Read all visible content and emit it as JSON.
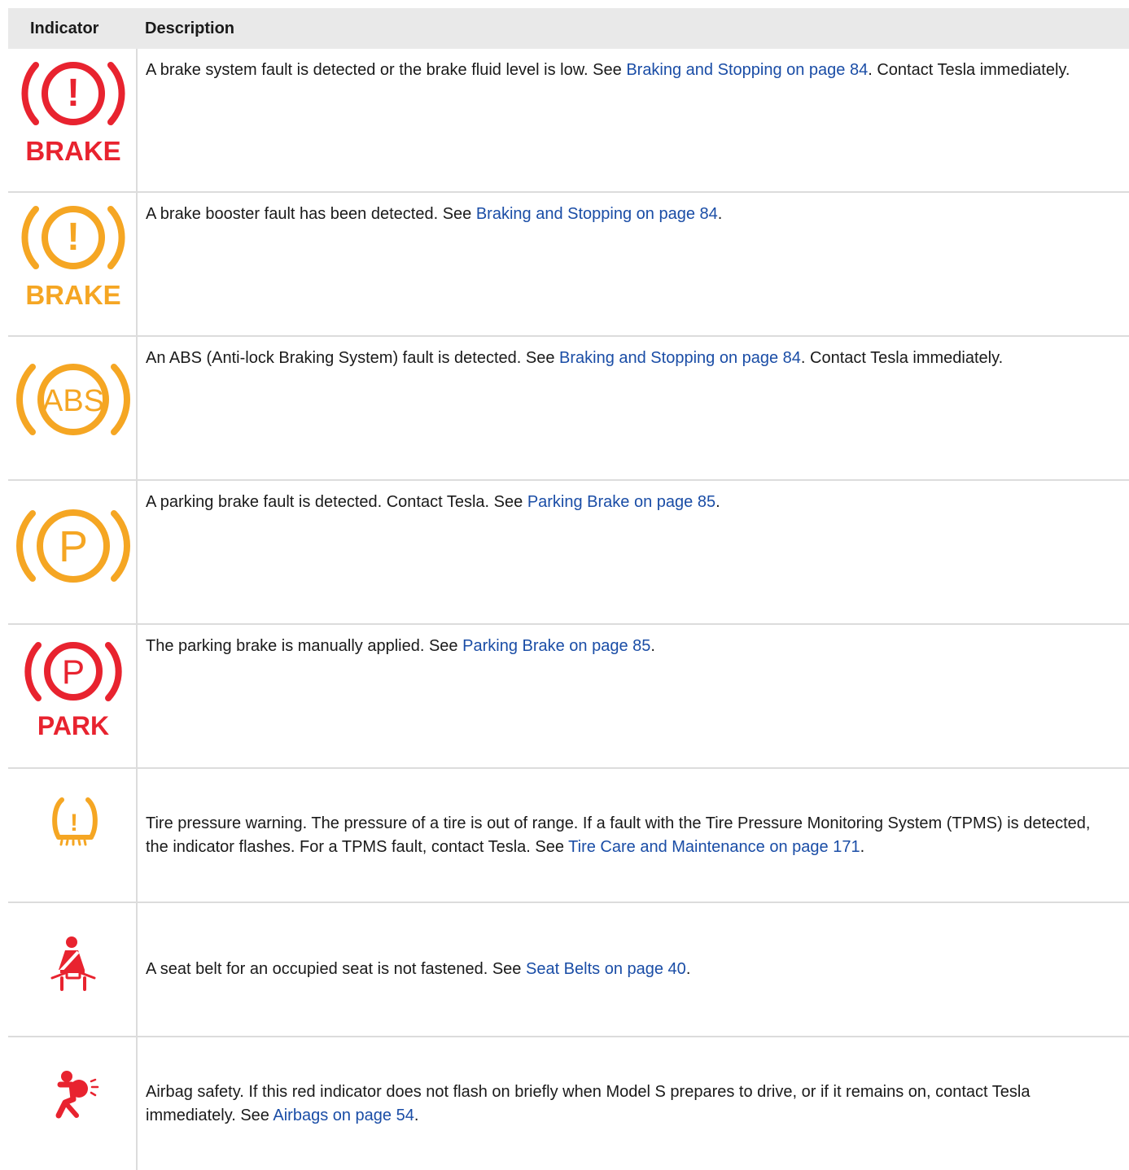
{
  "table": {
    "headers": {
      "indicator": "Indicator",
      "description": "Description"
    },
    "rows": [
      {
        "icon": "brake-red-icon",
        "icon_text": "BRAKE",
        "color": "#e8232f",
        "text_before": "A brake system fault is detected or the brake fluid level is low. See ",
        "link": "Braking and Stopping on page 84",
        "text_after": ". Contact Tesla immediately."
      },
      {
        "icon": "brake-amber-icon",
        "icon_text": "BRAKE",
        "color": "#f5a623",
        "text_before": "A brake booster fault has been detected. See ",
        "link": "Braking and Stopping on page 84",
        "text_after": "."
      },
      {
        "icon": "abs-icon",
        "icon_text": "ABS",
        "color": "#f5a623",
        "text_before": "An ABS (Anti-lock Braking System) fault is detected. See ",
        "link": "Braking and Stopping on page 84",
        "text_after": ". Contact Tesla immediately."
      },
      {
        "icon": "parking-brake-fault-icon",
        "icon_text": "P",
        "color": "#f5a623",
        "text_before": "A parking brake fault is detected. Contact Tesla. See ",
        "link": "Parking Brake on page 85",
        "text_after": "."
      },
      {
        "icon": "parking-brake-applied-icon",
        "icon_text": "P",
        "icon_subtext": "PARK",
        "color": "#e8232f",
        "text_before": "The parking brake is manually applied. See ",
        "link": "Parking Brake on page 85",
        "text_after": "."
      },
      {
        "icon": "tire-pressure-icon",
        "icon_text": "!",
        "color": "#f5a623",
        "text_before": "Tire pressure warning. The pressure of a tire is out of range. If a fault with the Tire Pressure Monitoring System (TPMS) is detected, the indicator flashes. For a TPMS fault, contact Tesla. See ",
        "link": "Tire Care and Maintenance on page 171",
        "text_after": "."
      },
      {
        "icon": "seat-belt-icon",
        "color": "#e8232f",
        "text_before": "A seat belt for an occupied seat is not fastened. See ",
        "link": "Seat Belts on page 40",
        "text_after": "."
      },
      {
        "icon": "airbag-icon",
        "color": "#e8232f",
        "text_before": "Airbag safety. If this red indicator does not flash on briefly when Model S prepares to drive, or if it remains on, contact Tesla immediately. See ",
        "link": "Airbags on page 54",
        "text_after": "."
      }
    ]
  }
}
